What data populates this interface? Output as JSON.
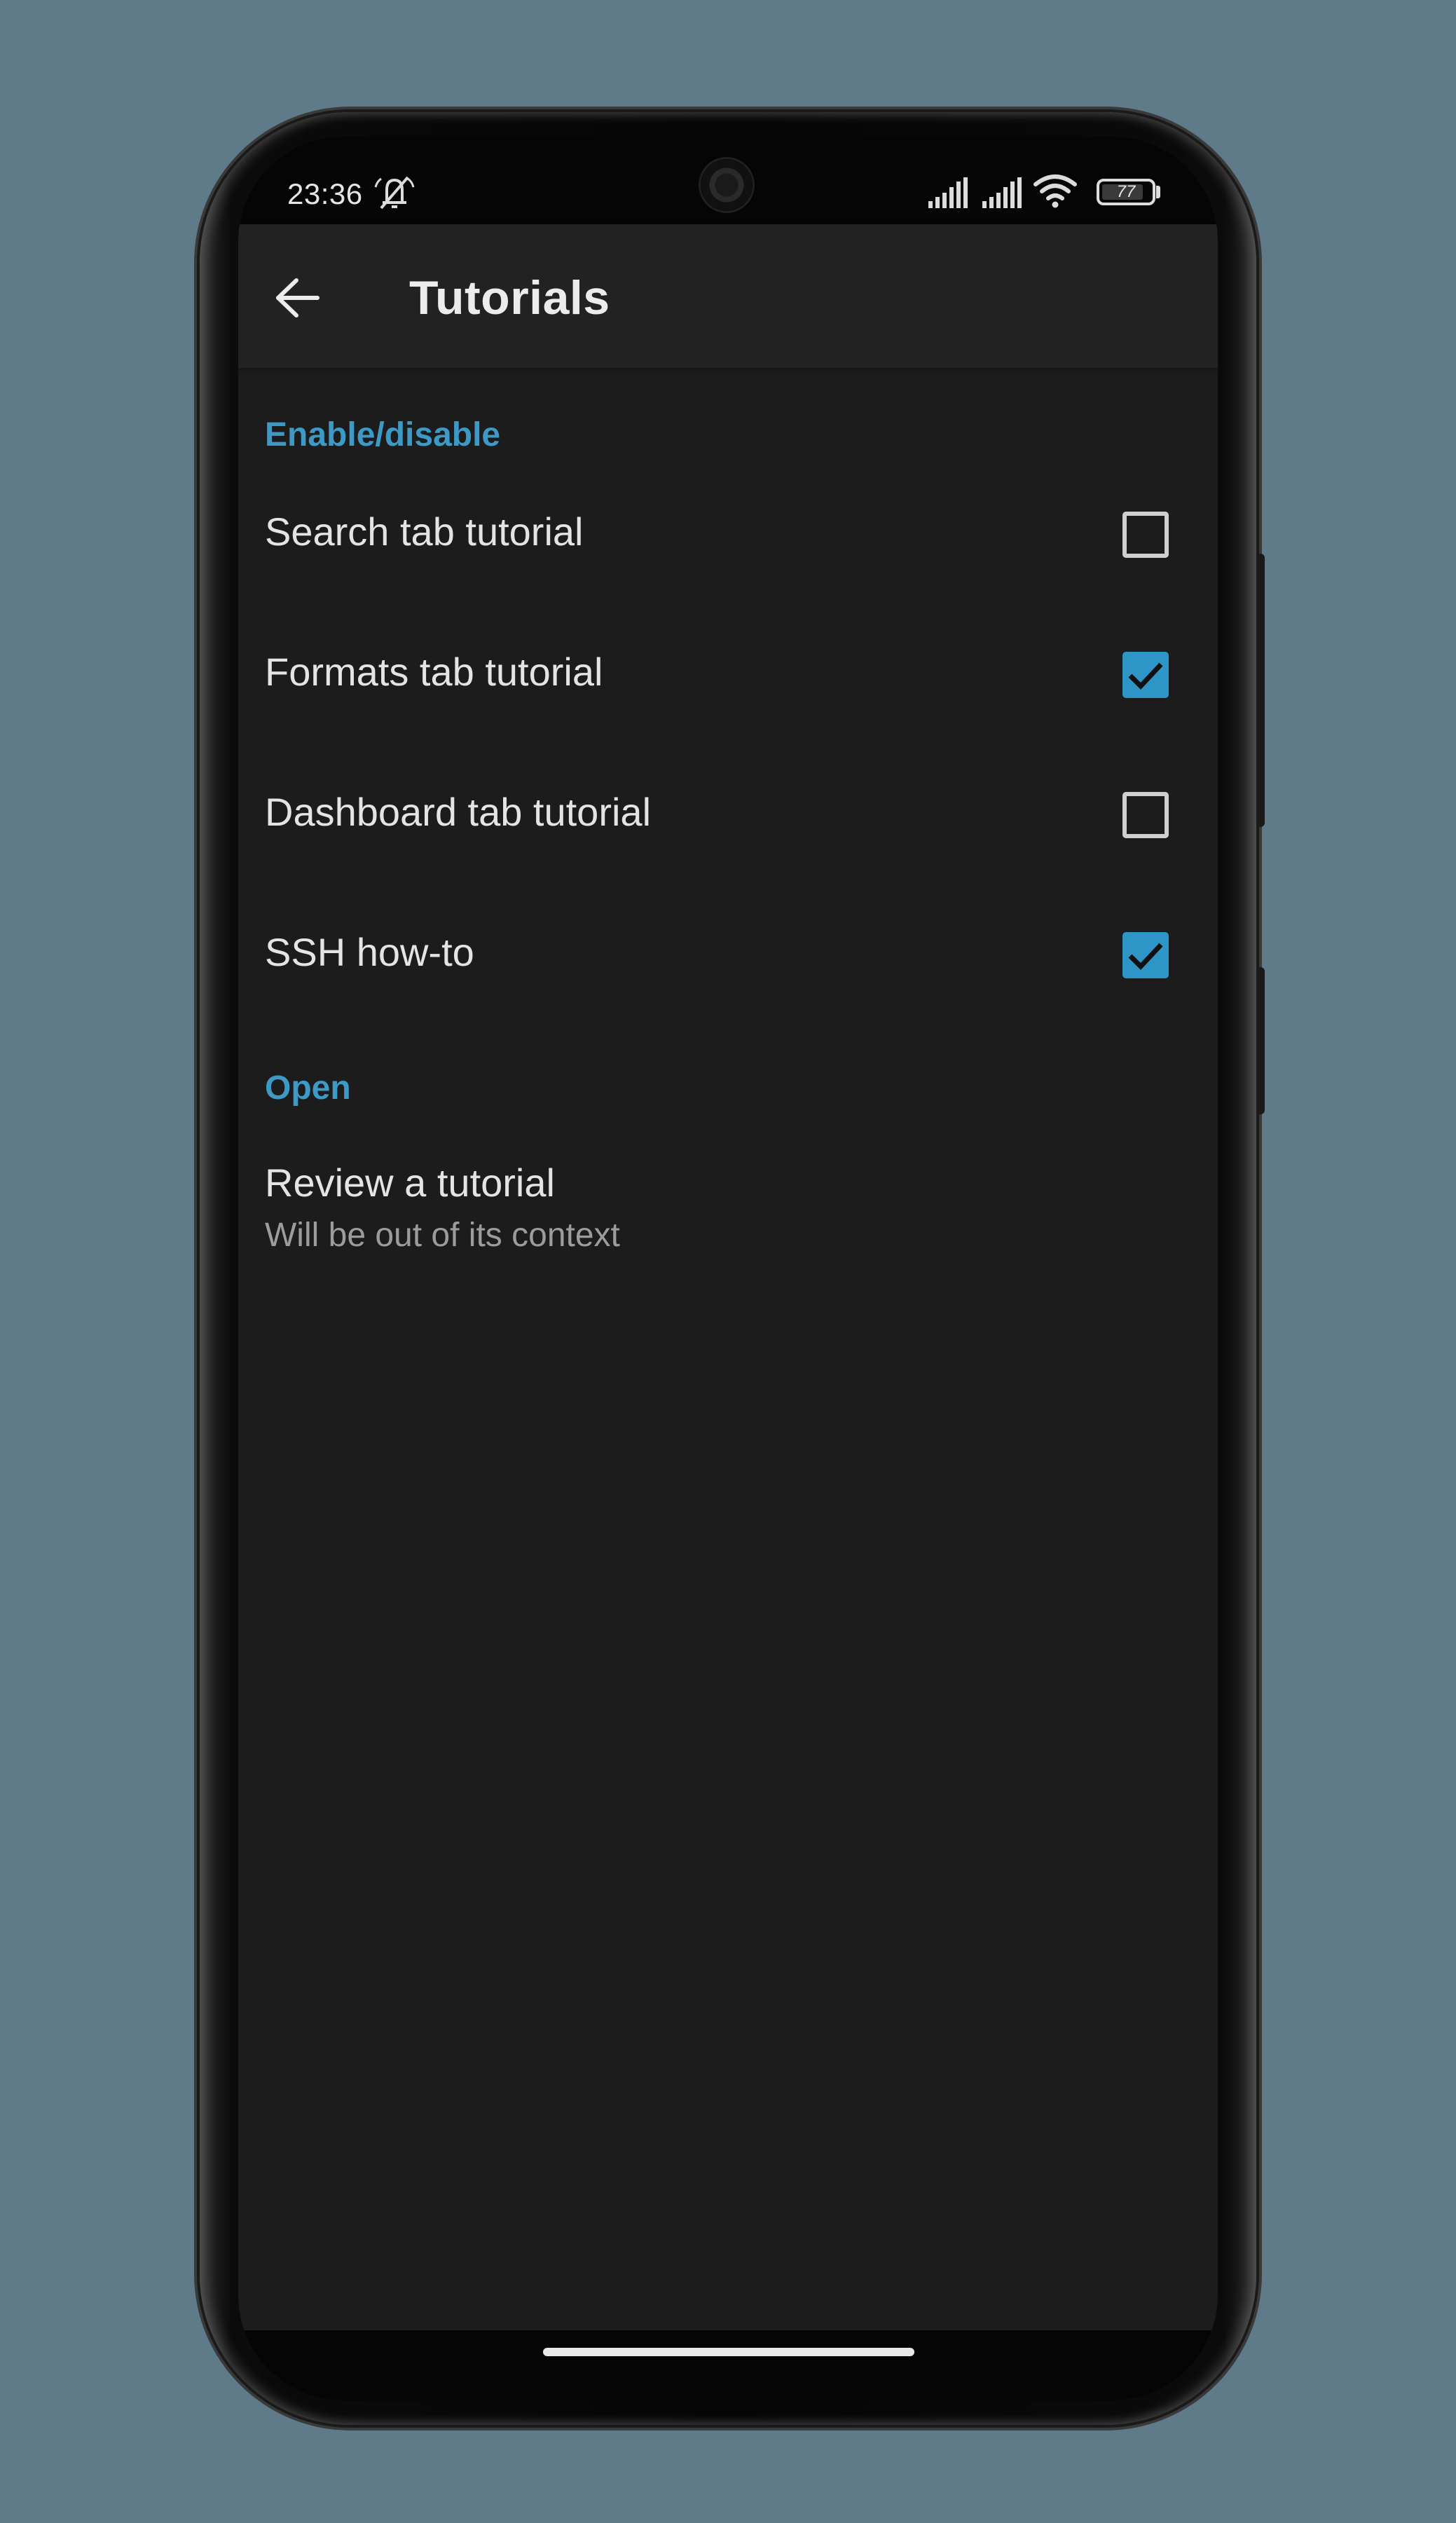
{
  "status_bar": {
    "time": "23:36",
    "battery_level": "77",
    "icons": [
      "dnd-off-icon",
      "signal-icon",
      "signal-icon",
      "wifi-icon",
      "battery-icon"
    ]
  },
  "app_bar": {
    "back_icon": "arrow-left-icon",
    "title": "Tutorials"
  },
  "sections": {
    "enable_disable": {
      "header": "Enable/disable",
      "items": [
        {
          "label": "Search tab tutorial",
          "checked": false
        },
        {
          "label": "Formats tab tutorial",
          "checked": true
        },
        {
          "label": "Dashboard tab tutorial",
          "checked": false
        },
        {
          "label": "SSH how-to",
          "checked": true
        }
      ]
    },
    "open": {
      "header": "Open",
      "review": {
        "title": "Review a tutorial",
        "summary": "Will be out of its context"
      }
    }
  },
  "colors": {
    "accent": "#3d9ac7",
    "checkbox_checked": "#2e95c7",
    "background": "#1c1c1c",
    "app_bar": "#222222",
    "page_background": "#5f7b8a"
  }
}
